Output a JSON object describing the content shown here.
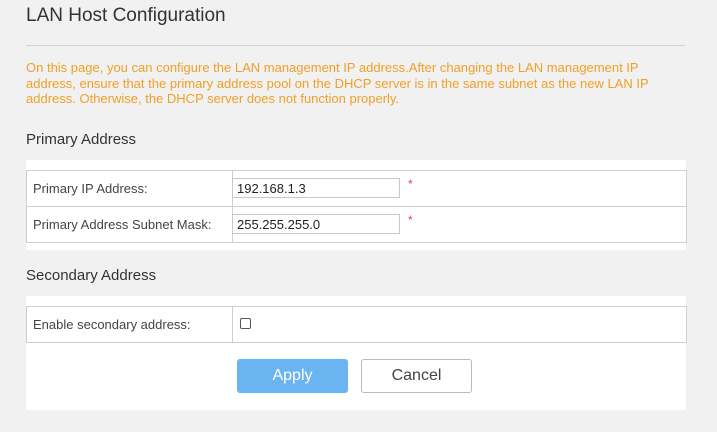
{
  "page": {
    "title": "LAN Host Configuration",
    "notice": "On this page, you can configure the LAN management IP address.After changing the LAN management IP address, ensure that the primary address pool on the DHCP server is in the same subnet as the new LAN IP address. Otherwise, the DHCP server does not function properly."
  },
  "primary": {
    "heading": "Primary Address",
    "ip_label": "Primary IP Address:",
    "ip_value": "192.168.1.3",
    "mask_label": "Primary Address Subnet Mask:",
    "mask_value": "255.255.255.0",
    "required_mark": "*"
  },
  "secondary": {
    "heading": "Secondary Address",
    "enable_label": "Enable secondary address:",
    "enabled": false
  },
  "actions": {
    "apply_label": "Apply",
    "cancel_label": "Cancel"
  },
  "colors": {
    "notice": "#f0a028",
    "apply_button": "#6ab4f1",
    "required": "#e04848"
  }
}
